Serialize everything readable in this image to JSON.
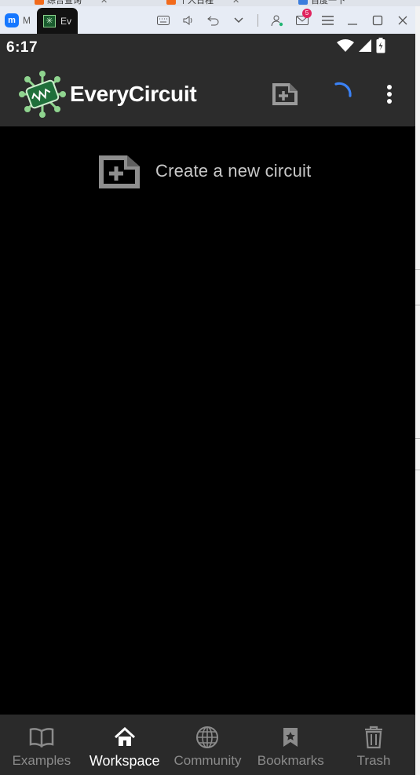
{
  "background_tabs": [
    {
      "label": "综合查询",
      "color": "#f26a1b"
    },
    {
      "label": "个人日程",
      "color": "#f26a1b"
    },
    {
      "label": "百度一下",
      "color": "#3b7ddd"
    }
  ],
  "titlebar": {
    "tabs": [
      {
        "label": "M",
        "icon": "m-logo-icon"
      },
      {
        "label": "Ev",
        "icon": "everycircuit-icon"
      }
    ],
    "mail_badge": "5",
    "icons": [
      "keyboard-icon",
      "volume-icon",
      "undo-icon",
      "chevron-down-icon",
      "person-icon",
      "mail-icon",
      "menu-icon",
      "minimize-icon",
      "maximize-icon",
      "close-icon"
    ]
  },
  "statusbar": {
    "time": "6:17"
  },
  "appbar": {
    "title": "EveryCircuit",
    "spinner_color": "#3b82f6"
  },
  "main": {
    "create_label": "Create a new circuit"
  },
  "bottom_nav": {
    "items": [
      {
        "label": "Examples",
        "icon": "book-icon",
        "active": false
      },
      {
        "label": "Workspace",
        "icon": "home-icon",
        "active": true
      },
      {
        "label": "Community",
        "icon": "globe-icon",
        "active": false
      },
      {
        "label": "Bookmarks",
        "icon": "bookmark-icon",
        "active": false
      },
      {
        "label": "Trash",
        "icon": "trash-icon",
        "active": false
      }
    ]
  },
  "colors": {
    "device_bg": "#000000",
    "bar_bg": "#2c2c2c",
    "nav_inactive": "#8b8b8b",
    "nav_active": "#ffffff"
  }
}
